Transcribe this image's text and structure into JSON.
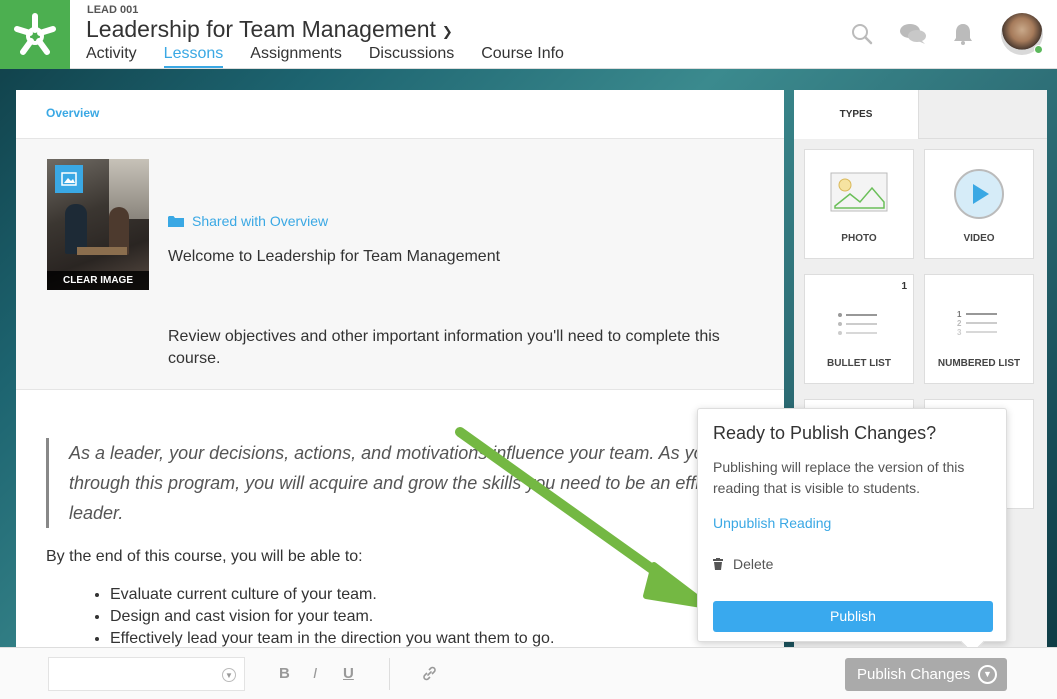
{
  "header": {
    "course_code": "LEAD 001",
    "course_title": "Leadership for Team Management",
    "tabs": [
      {
        "label": "Activity"
      },
      {
        "label": "Lessons",
        "active": true
      },
      {
        "label": "Assignments"
      },
      {
        "label": "Discussions"
      },
      {
        "label": "Course Info"
      }
    ],
    "icons": [
      "search-icon",
      "chat-icon",
      "bell-icon"
    ],
    "brand_color": "#4caf50",
    "accent_color": "#3aa8e4"
  },
  "content": {
    "breadcrumb": "Overview",
    "thumbnail": {
      "clear_label": "CLEAR IMAGE"
    },
    "shared_label": "Shared with Overview",
    "intro_title": "Welcome to Leadership for Team Management",
    "intro_desc": "Review objectives and other important information you'll need to complete this course.",
    "quote": "As a leader, your decisions, actions, and motivations influence your team. As you go through this program, you will acquire and grow the skills you need to be an efficient leader.",
    "lead": "By the end of this course, you will be able to:",
    "objectives": [
      "Evaluate current culture of your team.",
      "Design and cast vision for your team.",
      "Effectively lead your team in the direction you want them to go."
    ]
  },
  "types_panel": {
    "tab_label": "TYPES",
    "tiles": [
      {
        "label": "PHOTO",
        "icon": "photo-icon"
      },
      {
        "label": "VIDEO",
        "icon": "video-icon"
      },
      {
        "label": "BULLET LIST",
        "icon": "bullet-list-icon",
        "count": "1"
      },
      {
        "label": "NUMBERED LIST",
        "icon": "numbered-list-icon"
      }
    ]
  },
  "publish_popover": {
    "title": "Ready to Publish Changes?",
    "description": "Publishing will replace the version of this reading that is visible to students.",
    "unpublish_label": "Unpublish Reading",
    "delete_label": "Delete",
    "publish_label": "Publish"
  },
  "toolbar": {
    "bold_label": "B",
    "italic_label": "I",
    "underline_label": "U",
    "publish_changes_label": "Publish Changes"
  }
}
